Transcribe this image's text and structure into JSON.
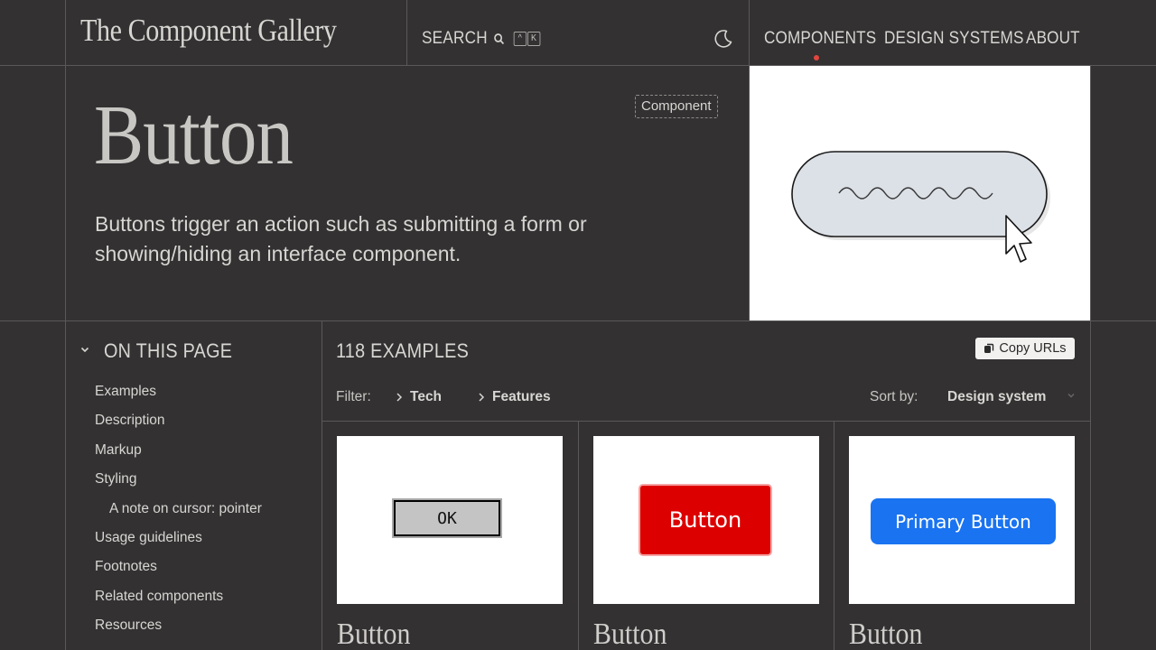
{
  "header": {
    "site_title": "The Component Gallery",
    "search_label": "SEARCH",
    "search_keys": [
      "^",
      "K"
    ],
    "nav": [
      {
        "label": "COMPONENTS",
        "active": true
      },
      {
        "label": "DESIGN SYSTEMS",
        "active": false
      },
      {
        "label": "ABOUT",
        "active": false
      }
    ]
  },
  "hero": {
    "title": "Button",
    "badge": "Component",
    "description": "Buttons trigger an action such as submitting a form or showing/hiding an interface component."
  },
  "toc": {
    "heading": "ON THIS PAGE",
    "items": [
      "Examples",
      "Description",
      "Markup",
      "Styling",
      "A note on cursor: pointer",
      "Usage guidelines",
      "Footnotes",
      "Related components",
      "Resources"
    ]
  },
  "examples": {
    "count_label": "118 EXAMPLES",
    "copy_label": "Copy URLs",
    "filter_label": "Filter:",
    "filters": [
      "Tech",
      "Features"
    ],
    "sort_label": "Sort by:",
    "sort_value": "Design system",
    "cards": [
      {
        "title": "Button",
        "preview_text": "OK"
      },
      {
        "title": "Button",
        "preview_text": "Button"
      },
      {
        "title": "Button",
        "preview_text": "Primary Button"
      }
    ]
  },
  "colors": {
    "background": "#333132",
    "nav_indicator": "#e2463f",
    "red_button": "#dd0000",
    "blue_button": "#1a73f0"
  },
  "icons": [
    "search-icon",
    "moon-icon",
    "chevron-down-icon",
    "chevron-right-icon",
    "copy-icon",
    "cursor-icon"
  ]
}
